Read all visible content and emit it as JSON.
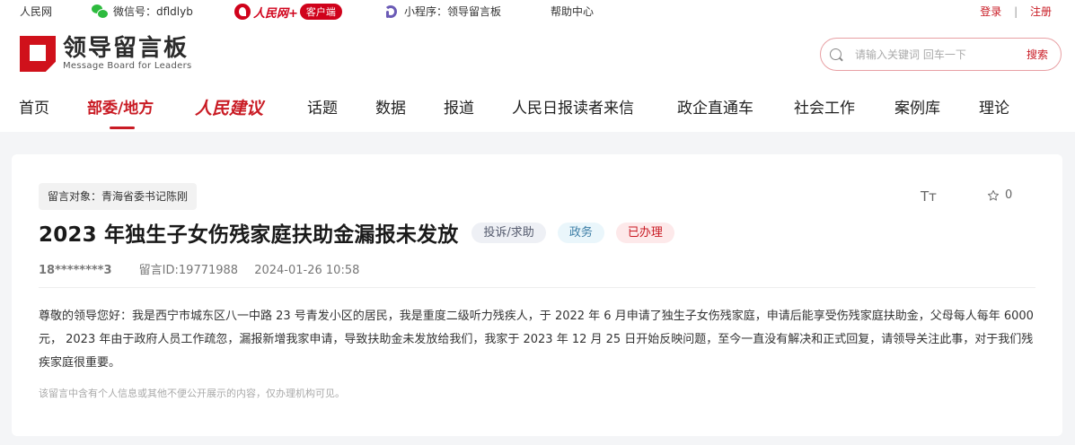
{
  "topbar": {
    "site": "人民网",
    "wechat": "微信号：dfldlyb",
    "app_name": "人民网+",
    "app_client": "客户端",
    "mini_program": "小程序：领导留言板",
    "help": "帮助中心",
    "login": "登录",
    "separator": "|",
    "register": "注册"
  },
  "header": {
    "logo_cn": "领导留言板",
    "logo_en": "Message Board for Leaders",
    "search_placeholder": "请输入关键词 回车一下",
    "search_button": "搜索"
  },
  "nav": {
    "items": [
      "首页",
      "部委/地方",
      "人民建议",
      "话题",
      "数据",
      "报道",
      "人民日报读者来信",
      "政企直通车",
      "社会工作",
      "案例库",
      "理论"
    ],
    "active": "部委/地方"
  },
  "message": {
    "target": "留言对象：青海省委书记陈刚",
    "font_icon_label": "Tт",
    "fav_count": "0",
    "title": "2023 年独生子女伤残家庭扶助金漏报未发放",
    "tags": [
      "投诉/求助",
      "政务",
      "已办理"
    ],
    "user": "18********3",
    "message_id": "留言ID:19771988",
    "datetime": "2024-01-26 10:58",
    "content": "尊敬的领导您好：我是西宁市城东区八一中路 23 号青发小区的居民，我是重度二级听力残疾人，于 2022 年 6 月申请了独生子女伤残家庭，申请后能享受伤残家庭扶助金，父母每人每年 6000 元， 2023 年由于政府人员工作疏忽，漏报新增我家申请，导致扶助金未发放给我们，我家于 2023 年 12 月 25 日开始反映问题，至今一直没有解决和正式回复，请领导关注此事，对于我们残疾家庭很重要。",
    "privacy_note": "该留言中含有个人信息或其他不便公开展示的内容，仅办理机构可见。"
  },
  "colors": {
    "brand_red": "#c91b24",
    "wechat_green": "#2dbb3e",
    "mini_purple": "#6b5bb6"
  }
}
